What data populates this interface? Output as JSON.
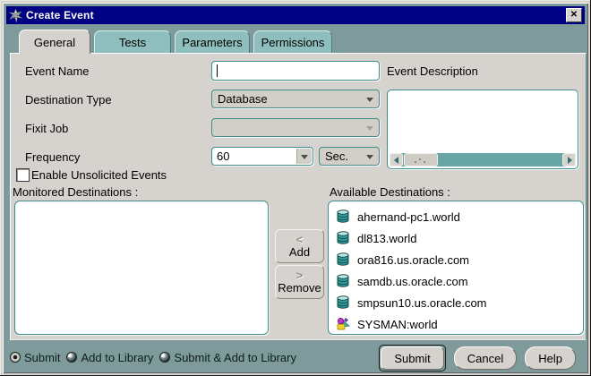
{
  "window": {
    "title": "Create Event",
    "close_glyph": "✕"
  },
  "tabs": [
    {
      "label": "General",
      "active": true
    },
    {
      "label": "Tests",
      "active": false
    },
    {
      "label": "Parameters",
      "active": false
    },
    {
      "label": "Permissions",
      "active": false
    }
  ],
  "form": {
    "event_name": {
      "label": "Event Name",
      "value": ""
    },
    "destination_type": {
      "label": "Destination Type",
      "value": "Database"
    },
    "fixit_job": {
      "label": "Fixit Job",
      "value": "",
      "disabled": true
    },
    "frequency": {
      "label": "Frequency",
      "value": "60",
      "unit": "Sec."
    },
    "event_description": {
      "label": "Event Description",
      "value": ""
    },
    "enable_unsolicited": {
      "label": "Enable Unsolicited Events",
      "checked": false
    }
  },
  "lists": {
    "monitored": {
      "label": "Monitored Destinations :",
      "items": []
    },
    "available": {
      "label": "Available Destinations :",
      "items": [
        {
          "icon": "database-icon",
          "name": "ahernand-pc1.world"
        },
        {
          "icon": "database-icon",
          "name": "dl813.world"
        },
        {
          "icon": "database-icon",
          "name": "ora816.us.oracle.com"
        },
        {
          "icon": "database-icon",
          "name": "samdb.us.oracle.com"
        },
        {
          "icon": "database-icon",
          "name": "smpsun10.us.oracle.com"
        },
        {
          "icon": "group-icon",
          "name": "SYSMAN:world"
        }
      ]
    }
  },
  "transfer": {
    "add_label": "Add",
    "add_arrow": "<",
    "remove_label": "Remove",
    "remove_arrow": ">"
  },
  "footer": {
    "radios": [
      {
        "label": "Submit",
        "selected": true
      },
      {
        "label": "Add to Library",
        "selected": false
      },
      {
        "label": "Submit & Add to Library",
        "selected": false
      }
    ],
    "buttons": [
      {
        "label": "Submit",
        "default": true
      },
      {
        "label": "Cancel",
        "default": false
      },
      {
        "label": "Help",
        "default": false
      }
    ]
  },
  "colors": {
    "titlebar": "#000082",
    "dialog_background": "#7e9a9a",
    "panel_background": "#d6d3ce",
    "inactive_tab": "#8fbebe",
    "field_border": "#3f8c8c",
    "scrollbar_track": "#68a6a6",
    "database_icon_teal": "#2f9898",
    "group_icon_magenta": "#cc33cc"
  }
}
